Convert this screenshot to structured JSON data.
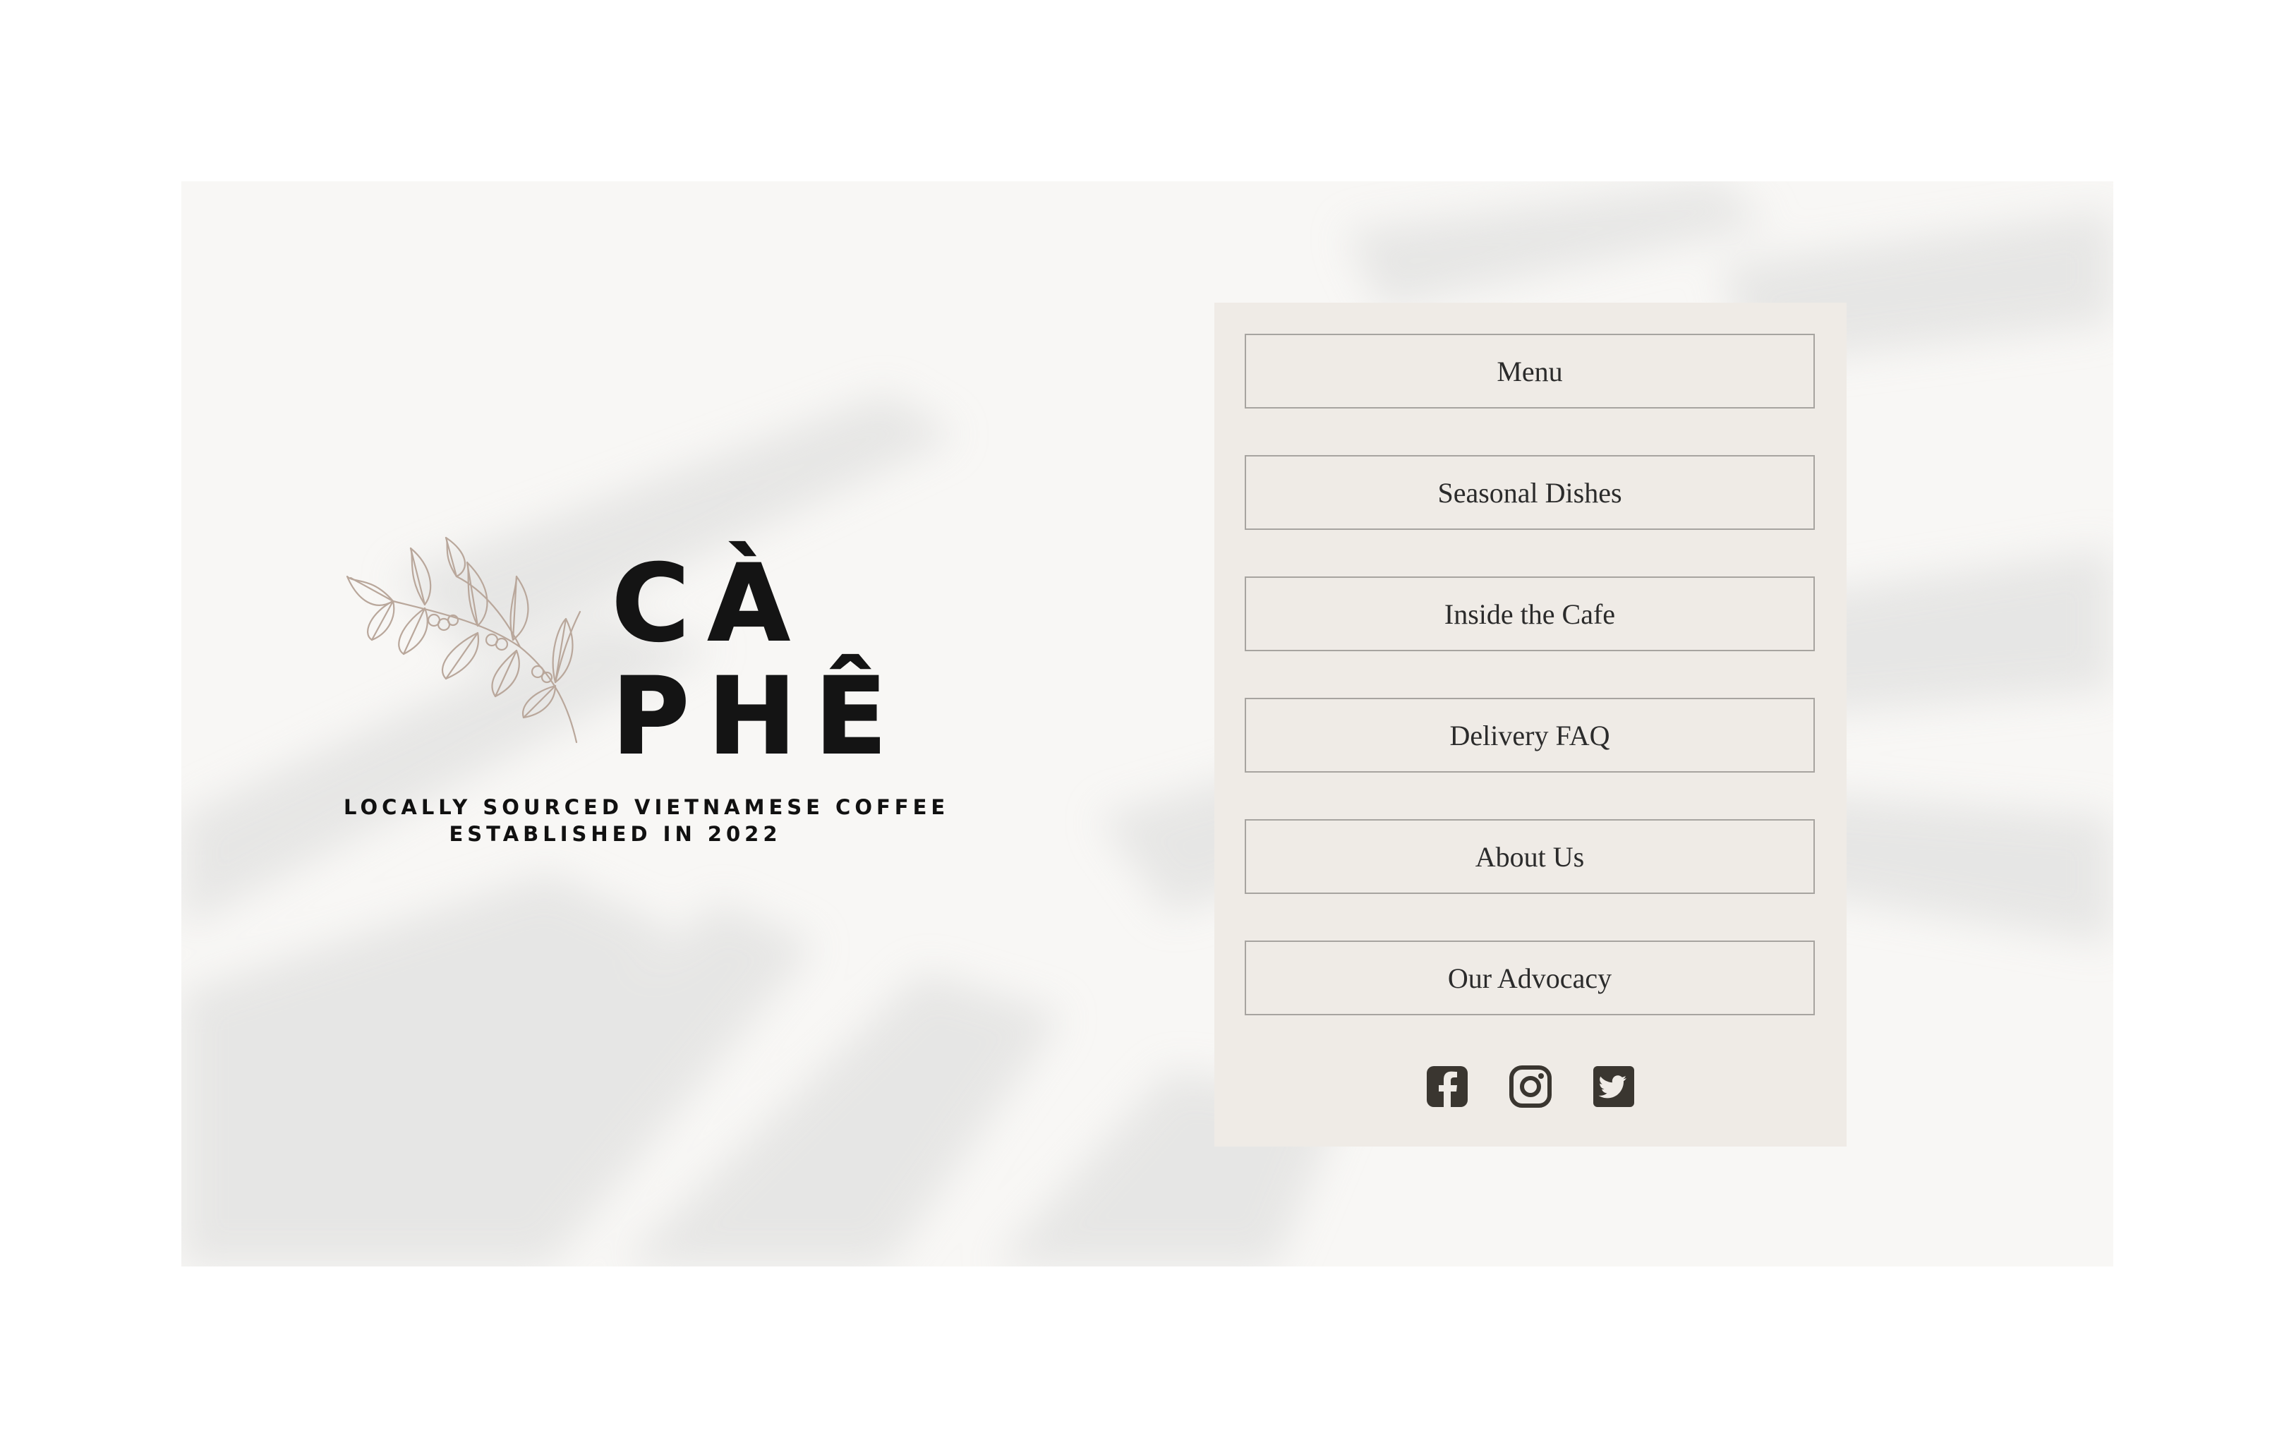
{
  "brand": {
    "wordmark_line1": "CÀ",
    "wordmark_line2": "PHÊ",
    "tagline_line1": "LOCALLY SOURCED VIETNAMESE COFFEE",
    "tagline_line2": "ESTABLISHED IN 2022",
    "branch_icon": "coffee-branch-icon"
  },
  "nav": {
    "items": [
      {
        "label": "Menu"
      },
      {
        "label": "Seasonal Dishes"
      },
      {
        "label": "Inside the Cafe"
      },
      {
        "label": "Delivery FAQ"
      },
      {
        "label": "About Us"
      },
      {
        "label": "Our Advocacy"
      }
    ]
  },
  "socials": [
    {
      "icon": "facebook-icon"
    },
    {
      "icon": "instagram-icon"
    },
    {
      "icon": "twitter-icon"
    }
  ],
  "colors": {
    "page_background": "#ffffff",
    "card_background": "#f8f7f5",
    "panel_background": "#efebe6",
    "button_border": "#a7a4a0",
    "text_dark": "#2b2b2b",
    "icon_dark": "#3a3630",
    "branch_stroke": "#b9a79b"
  }
}
